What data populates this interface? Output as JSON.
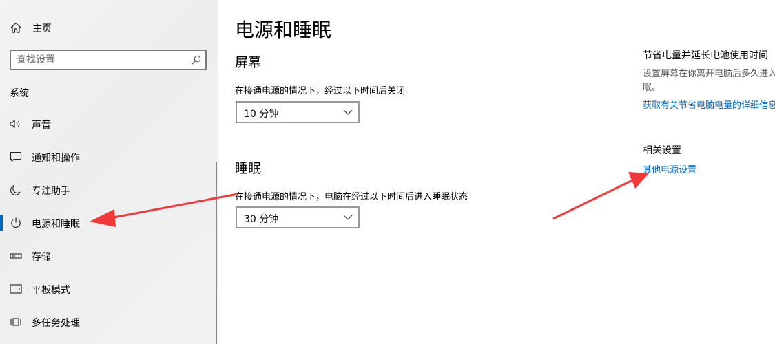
{
  "sidebar": {
    "home_label": "主页",
    "search_placeholder": "查找设置",
    "section": "系统",
    "items": [
      {
        "label": "声音",
        "icon": "speaker-icon"
      },
      {
        "label": "通知和操作",
        "icon": "message-icon"
      },
      {
        "label": "专注助手",
        "icon": "moon-icon"
      },
      {
        "label": "电源和睡眠",
        "icon": "power-icon",
        "active": true
      },
      {
        "label": "存储",
        "icon": "storage-icon"
      },
      {
        "label": "平板模式",
        "icon": "tablet-icon"
      },
      {
        "label": "多任务处理",
        "icon": "multitask-icon"
      }
    ]
  },
  "main": {
    "title": "电源和睡眠",
    "screen": {
      "heading": "屏幕",
      "description": "在接通电源的情况下，经过以下时间后关闭",
      "value": "10 分钟"
    },
    "sleep": {
      "heading": "睡眠",
      "description": "在接通电源的情况下，电脑在经过以下时间后进入睡眠状态",
      "value": "30 分钟"
    }
  },
  "right_panel": {
    "save_heading": "节省电量并延长电池使用时间",
    "save_text": "设置屏幕在你离开电脑后多久进入睡眠。",
    "save_link": "获取有关节省电脑电量的详细信息",
    "related_heading": "相关设置",
    "related_link": "其他电源设置"
  },
  "colors": {
    "accent": "#0067b8",
    "annotation_arrow": "#f03a3a",
    "sidebar_bg": "#f0f0f0"
  }
}
